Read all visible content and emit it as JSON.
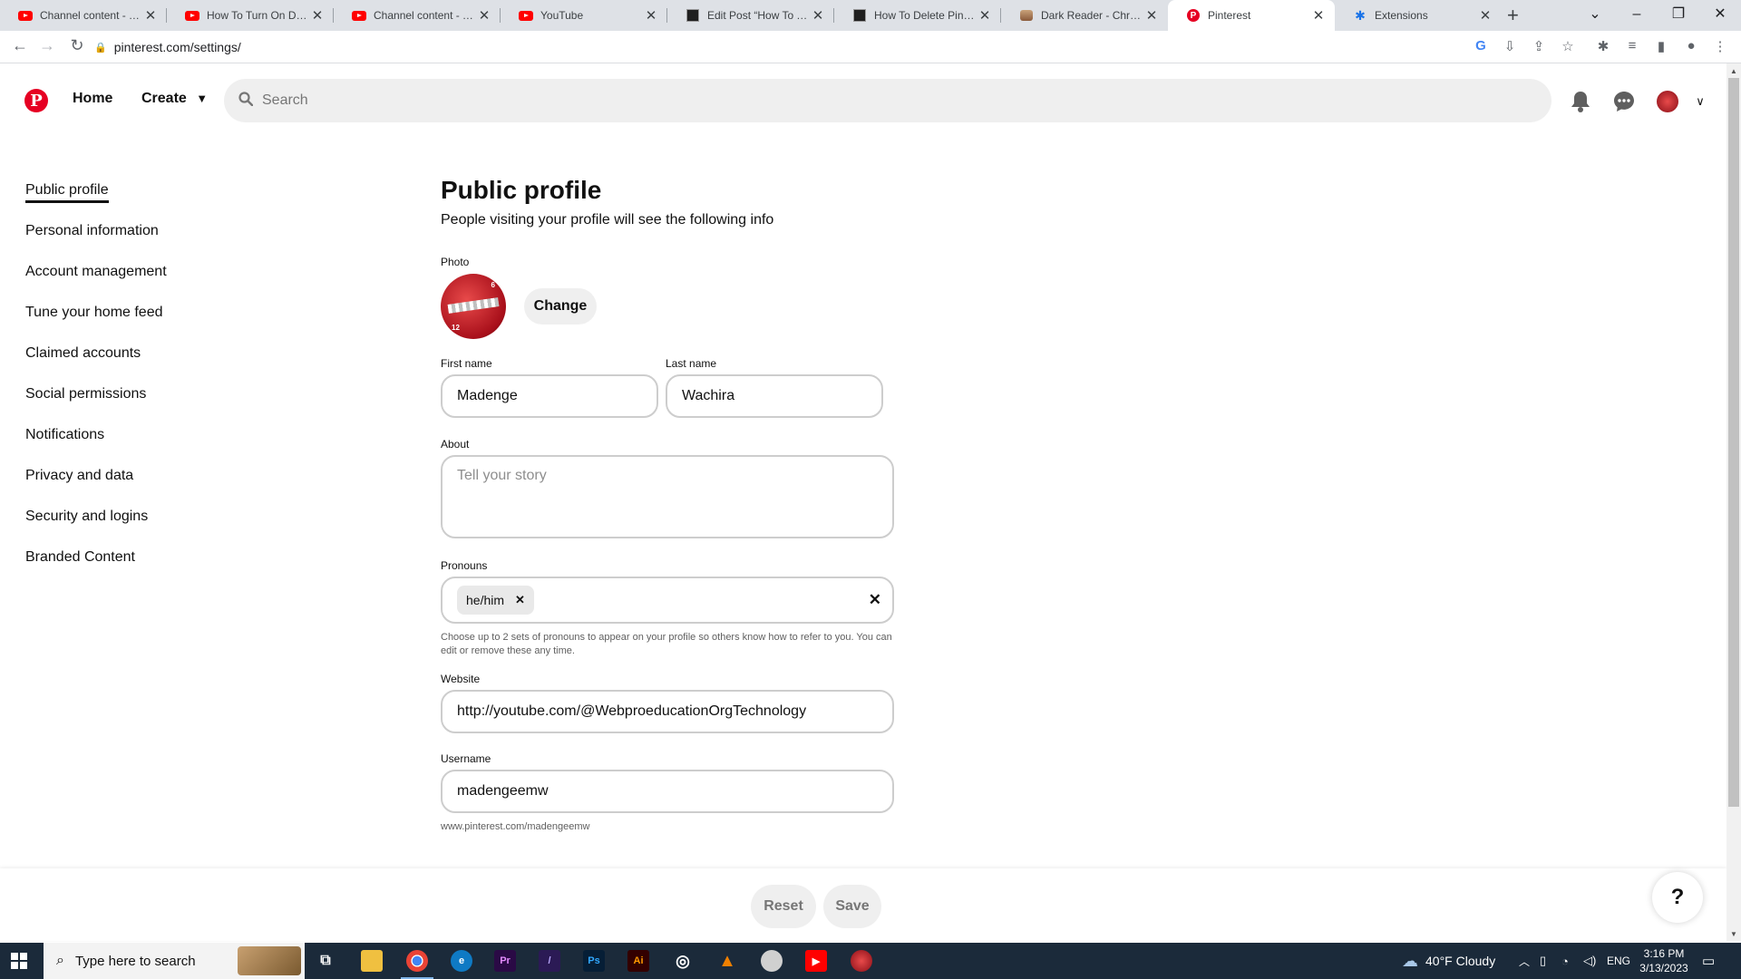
{
  "browser": {
    "tabs": [
      {
        "title": "Channel content - YouTube Studio",
        "icon": "youtube-icon",
        "active": false
      },
      {
        "title": "How To Turn On Dark Mode",
        "icon": "youtube-icon",
        "active": false
      },
      {
        "title": "Channel content - YouTube Studio",
        "icon": "youtube-icon",
        "active": false
      },
      {
        "title": "YouTube",
        "icon": "youtube-icon",
        "active": false
      },
      {
        "title": "Edit Post “How To Turn",
        "icon": "blog-icon",
        "active": false
      },
      {
        "title": "How To Delete Pins On",
        "icon": "blog-icon",
        "active": false
      },
      {
        "title": "Dark Reader - Chrome Web Store",
        "icon": "dark-reader-icon",
        "active": false
      },
      {
        "title": "Pinterest",
        "icon": "pinterest-icon",
        "active": true
      },
      {
        "title": "Extensions",
        "icon": "puzzle-icon",
        "active": false
      }
    ],
    "url": "pinterest.com/settings/"
  },
  "header": {
    "home_label": "Home",
    "create_label": "Create",
    "search_placeholder": "Search"
  },
  "sidebar": {
    "items": [
      {
        "label": "Public profile",
        "active": true
      },
      {
        "label": "Personal information"
      },
      {
        "label": "Account management"
      },
      {
        "label": "Tune your home feed"
      },
      {
        "label": "Claimed accounts"
      },
      {
        "label": "Social permissions"
      },
      {
        "label": "Notifications"
      },
      {
        "label": "Privacy and data"
      },
      {
        "label": "Security and logins"
      },
      {
        "label": "Branded Content"
      }
    ]
  },
  "profile": {
    "title": "Public profile",
    "subtitle": "People visiting your profile will see the following info",
    "photo_label": "Photo",
    "change_label": "Change",
    "first_name_label": "First name",
    "first_name": "Madenge",
    "last_name_label": "Last name",
    "last_name": "Wachira",
    "about_label": "About",
    "about_placeholder": "Tell your story",
    "pronouns_label": "Pronouns",
    "pronoun_chip": "he/him",
    "pronouns_hint": "Choose up to 2 sets of pronouns to appear on your profile so others know how to refer to you. You can edit or remove these any time.",
    "website_label": "Website",
    "website": "http://youtube.com/@WebproeducationOrgTechnology",
    "username_label": "Username",
    "username": "madengeemw",
    "profile_url": "www.pinterest.com/madengeemw"
  },
  "actions": {
    "reset_label": "Reset",
    "save_label": "Save",
    "help_label": "?"
  },
  "taskbar": {
    "search_placeholder": "Type here to search",
    "weather": "40°F  Cloudy",
    "language": "ENG",
    "time": "3:16 PM",
    "date": "3/13/2023"
  },
  "colors": {
    "pinterest_red": "#e60023",
    "input_border": "#cdcdcd",
    "button_gray": "#efefef"
  }
}
